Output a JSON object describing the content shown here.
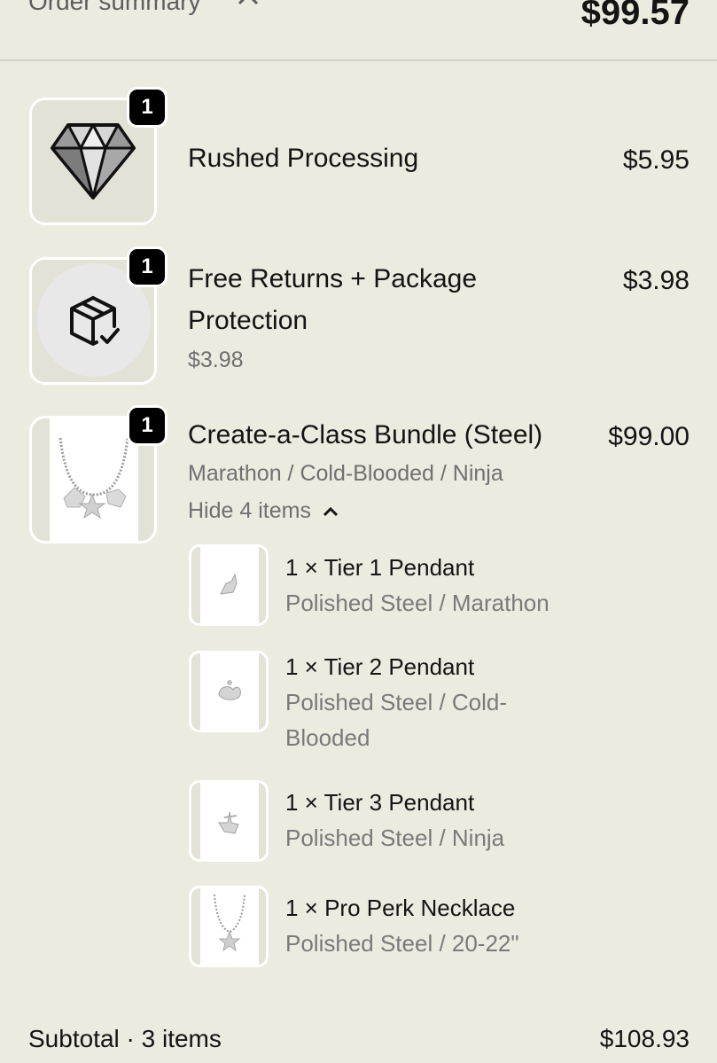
{
  "summary": {
    "label": "Order summary",
    "total": "$99.57"
  },
  "items": [
    {
      "icon": "diamond-icon",
      "quantity": "1",
      "title": "Rushed Processing",
      "price": "$5.95"
    },
    {
      "icon": "package-check-icon",
      "quantity": "1",
      "title_line1": "Free Returns + Package",
      "title_line2": "Protection",
      "subprice": "$3.98",
      "price": "$3.98"
    },
    {
      "icon": "necklace-image",
      "quantity": "1",
      "title": "Create-a-Class Bundle (Steel)",
      "variant": "Marathon / Cold-Blooded / Ninja",
      "toggle_label": "Hide 4 items",
      "price": "$99.00",
      "components": [
        {
          "name": "1 × Tier 1 Pendant",
          "desc_line1": "Polished Steel / Marathon",
          "desc_line2": ""
        },
        {
          "name": "1 × Tier 2 Pendant",
          "desc_line1": "Polished Steel / Cold-",
          "desc_line2": "Blooded"
        },
        {
          "name": "1 × Tier 3 Pendant",
          "desc_line1": "Polished Steel / Ninja",
          "desc_line2": ""
        },
        {
          "name": "1 × Pro Perk Necklace",
          "desc_line1": "Polished Steel / 20-22\"",
          "desc_line2": ""
        }
      ]
    }
  ],
  "subtotal": {
    "label": "Subtotal · 3 items",
    "value": "$108.93"
  }
}
